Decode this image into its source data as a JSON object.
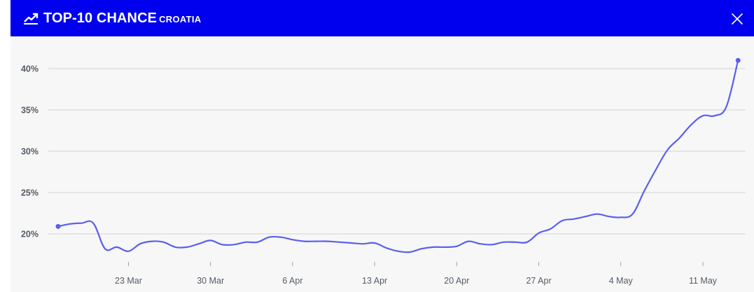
{
  "header": {
    "title": "TOP-10 CHANCE",
    "subtitle": "CROATIA",
    "icon": "trend-up-icon",
    "close_icon": "close-icon",
    "background_color": "#0000ee"
  },
  "chart_data": {
    "type": "line",
    "title": "",
    "xlabel": "",
    "ylabel": "",
    "ylim": [
      17,
      42
    ],
    "yticks": [
      20,
      25,
      30,
      35,
      40
    ],
    "ytick_labels": [
      "20%",
      "25%",
      "30%",
      "35%",
      "40%"
    ],
    "xlim": [
      "2024-03-17",
      "2024-05-15"
    ],
    "xticks": [
      "2024-03-23",
      "2024-03-30",
      "2024-04-06",
      "2024-04-13",
      "2024-04-20",
      "2024-04-27",
      "2024-05-04",
      "2024-05-11"
    ],
    "xtick_labels": [
      "23 Mar",
      "30 Mar",
      "6 Apr",
      "13 Apr",
      "20 Apr",
      "27 Apr",
      "4 May",
      "11 May"
    ],
    "grid": true,
    "line_color": "#5a5ff0",
    "series": [
      {
        "values": [
          [
            "2024-03-17",
            20.9
          ],
          [
            "2024-03-18",
            21.2
          ],
          [
            "2024-03-19",
            21.3
          ],
          [
            "2024-03-20",
            21.3
          ],
          [
            "2024-03-21",
            18.2
          ],
          [
            "2024-03-22",
            18.4
          ],
          [
            "2024-03-23",
            17.9
          ],
          [
            "2024-03-24",
            18.8
          ],
          [
            "2024-03-25",
            19.1
          ],
          [
            "2024-03-26",
            19.0
          ],
          [
            "2024-03-27",
            18.4
          ],
          [
            "2024-03-28",
            18.4
          ],
          [
            "2024-03-29",
            18.8
          ],
          [
            "2024-03-30",
            19.2
          ],
          [
            "2024-03-31",
            18.7
          ],
          [
            "2024-04-01",
            18.7
          ],
          [
            "2024-04-02",
            19.0
          ],
          [
            "2024-04-03",
            19.0
          ],
          [
            "2024-04-04",
            19.6
          ],
          [
            "2024-04-05",
            19.6
          ],
          [
            "2024-04-06",
            19.3
          ],
          [
            "2024-04-07",
            19.1
          ],
          [
            "2024-04-08",
            19.1
          ],
          [
            "2024-04-09",
            19.1
          ],
          [
            "2024-04-10",
            19.0
          ],
          [
            "2024-04-11",
            18.9
          ],
          [
            "2024-04-12",
            18.8
          ],
          [
            "2024-04-13",
            18.9
          ],
          [
            "2024-04-14",
            18.3
          ],
          [
            "2024-04-15",
            17.9
          ],
          [
            "2024-04-16",
            17.8
          ],
          [
            "2024-04-17",
            18.2
          ],
          [
            "2024-04-18",
            18.4
          ],
          [
            "2024-04-19",
            18.4
          ],
          [
            "2024-04-20",
            18.5
          ],
          [
            "2024-04-21",
            19.1
          ],
          [
            "2024-04-22",
            18.8
          ],
          [
            "2024-04-23",
            18.7
          ],
          [
            "2024-04-24",
            19.0
          ],
          [
            "2024-04-25",
            19.0
          ],
          [
            "2024-04-26",
            19.0
          ],
          [
            "2024-04-27",
            20.1
          ],
          [
            "2024-04-28",
            20.6
          ],
          [
            "2024-04-29",
            21.6
          ],
          [
            "2024-04-30",
            21.8
          ],
          [
            "2024-05-01",
            22.1
          ],
          [
            "2024-05-02",
            22.4
          ],
          [
            "2024-05-03",
            22.1
          ],
          [
            "2024-05-04",
            22.0
          ],
          [
            "2024-05-05",
            22.4
          ],
          [
            "2024-05-06",
            25.2
          ],
          [
            "2024-05-07",
            27.8
          ],
          [
            "2024-05-08",
            30.2
          ],
          [
            "2024-05-09",
            31.6
          ],
          [
            "2024-05-10",
            33.2
          ],
          [
            "2024-05-11",
            34.3
          ],
          [
            "2024-05-12",
            34.3
          ],
          [
            "2024-05-13",
            35.4
          ],
          [
            "2024-05-14",
            41.0
          ]
        ]
      }
    ]
  }
}
